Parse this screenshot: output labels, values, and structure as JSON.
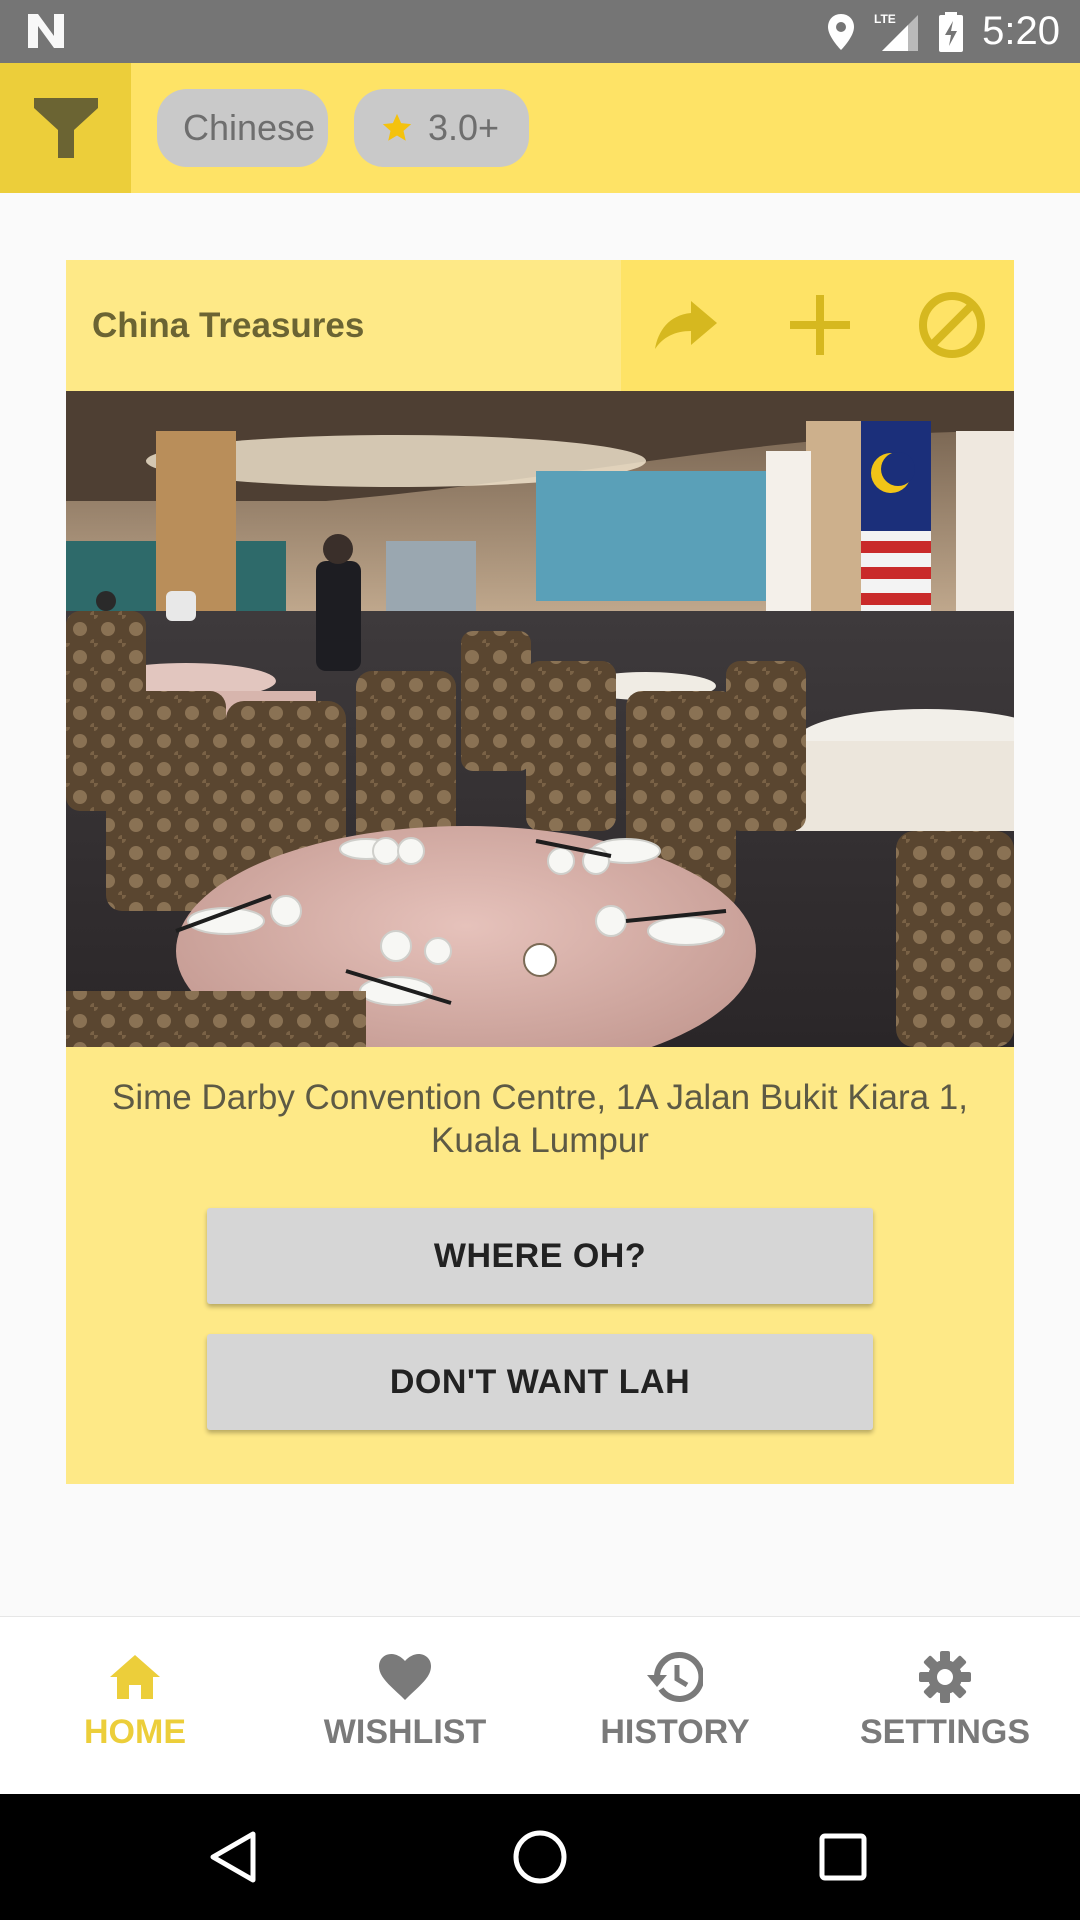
{
  "status_bar": {
    "network": "LTE",
    "time": "5:20"
  },
  "filters": {
    "cuisine_chip": "Chinese",
    "rating_chip": "3.0+"
  },
  "restaurant": {
    "name": "China Treasures",
    "address": "Sime Darby Convention Centre, 1A Jalan Bukit Kiara 1, Kuala Lumpur",
    "photo_index": 1,
    "photo_count": 1
  },
  "buttons": {
    "where": "WHERE OH?",
    "dont_want": "DON'T WANT LAH"
  },
  "bottom_nav": {
    "items": [
      {
        "label": "HOME",
        "icon": "home-icon",
        "active": true
      },
      {
        "label": "WISHLIST",
        "icon": "heart-icon",
        "active": false
      },
      {
        "label": "HISTORY",
        "icon": "history-icon",
        "active": false
      },
      {
        "label": "SETTINGS",
        "icon": "gear-icon",
        "active": false
      }
    ]
  },
  "colors": {
    "accent": "#ecce3a",
    "toolbar": "#fee366",
    "card": "#fee987",
    "chip": "#c9c9c9",
    "star": "#f4c20d"
  }
}
